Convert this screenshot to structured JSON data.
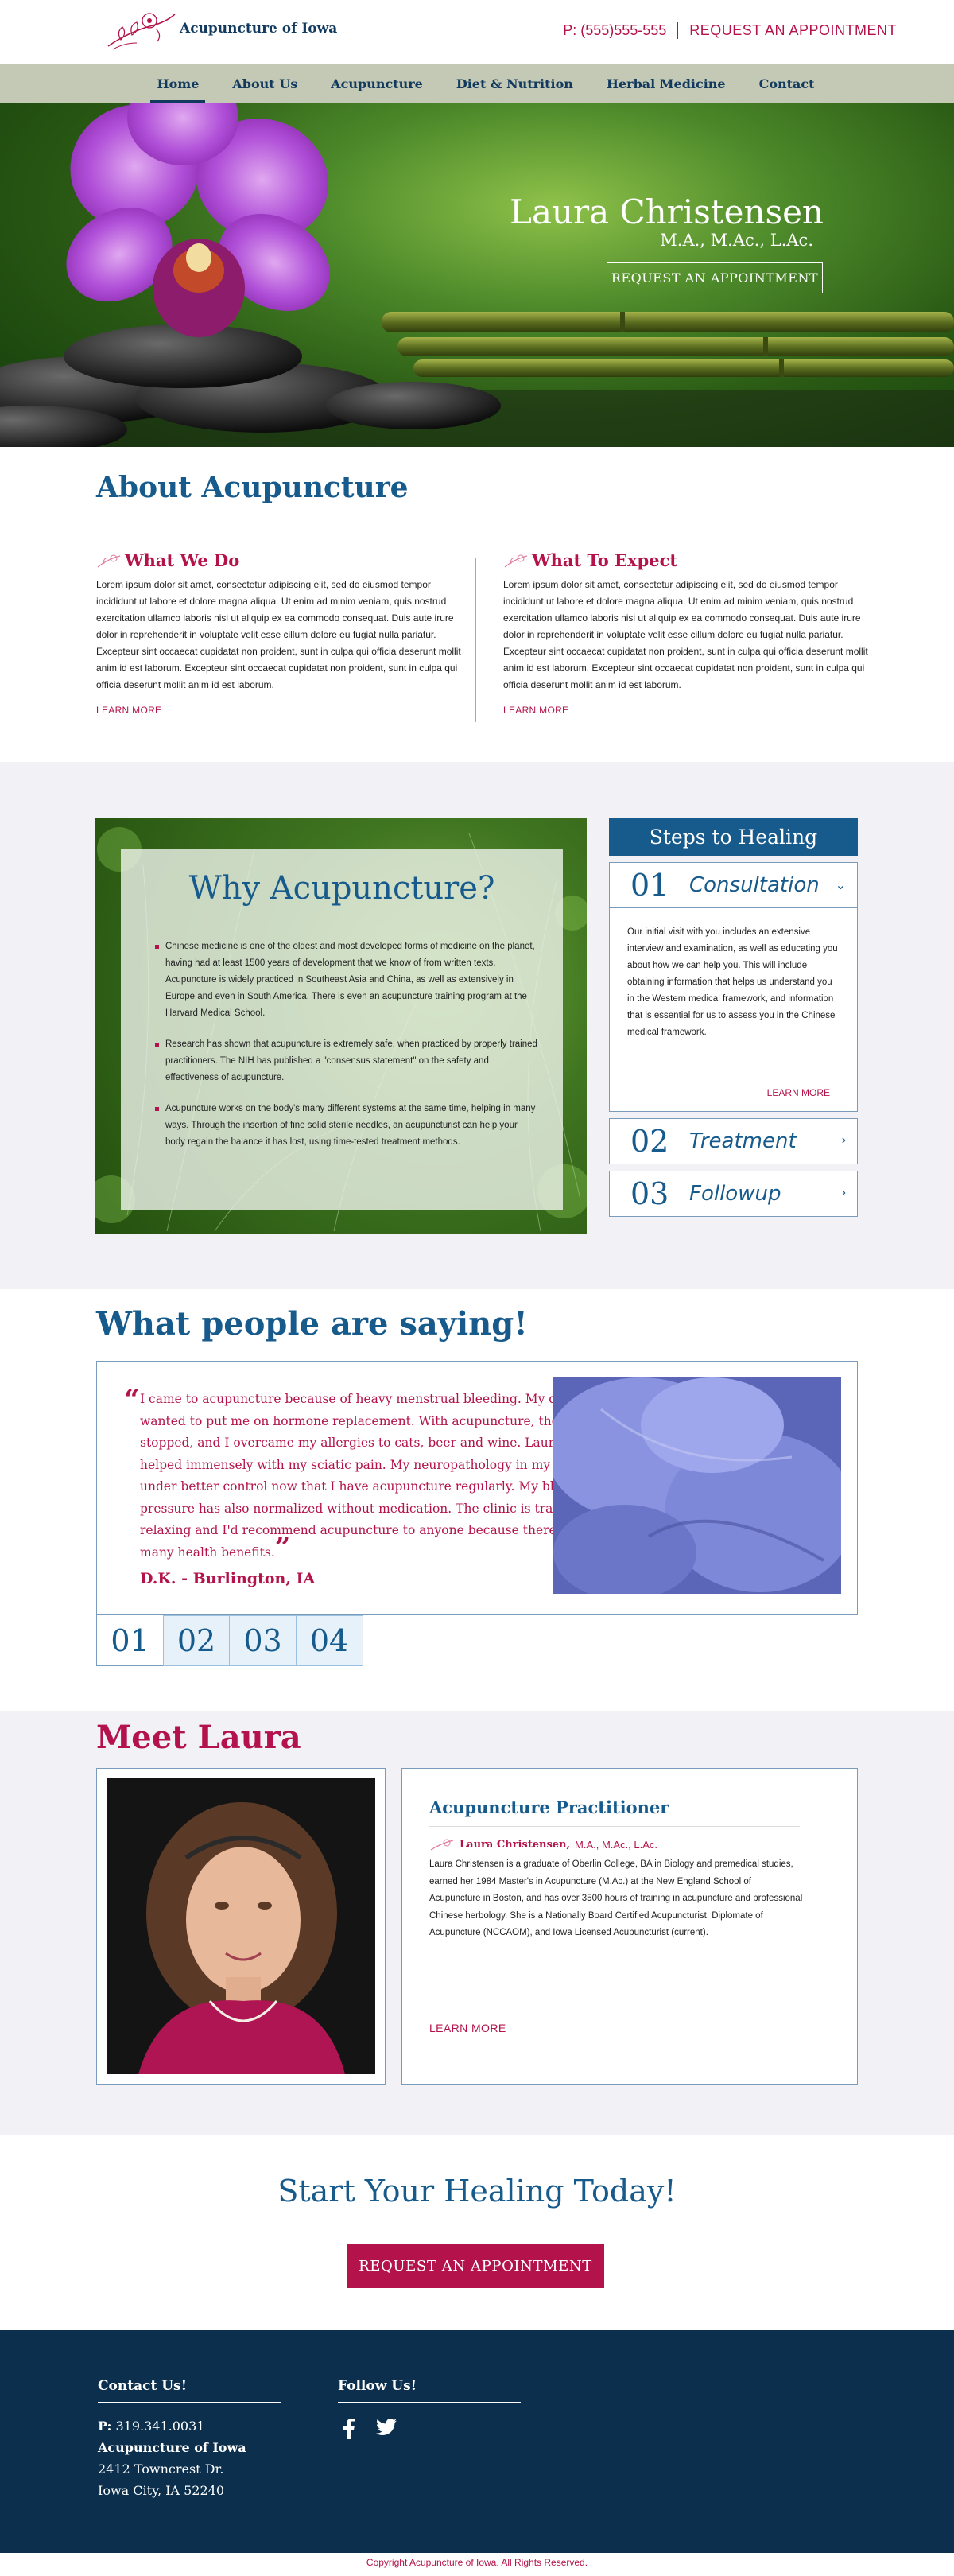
{
  "header": {
    "brand": "Acupuncture of Iowa",
    "phone": "P: (555)555-555",
    "appointment_link": "REQUEST AN APPOINTMENT"
  },
  "nav": {
    "items": [
      "Home",
      "About Us",
      "Acupuncture",
      "Diet & Nutrition",
      "Herbal Medicine",
      "Contact"
    ]
  },
  "hero": {
    "name": "Laura Christensen",
    "credentials": "M.A., M.Ac., L.Ac.",
    "button": "REQUEST AN APPOINTMENT"
  },
  "about": {
    "title": "About Acupuncture",
    "col1": {
      "heading": "What We Do",
      "text": "Lorem ipsum dolor sit amet, consectetur adipiscing elit, sed do eiusmod tempor incididunt ut labore et dolore magna aliqua. Ut enim ad minim veniam, quis nostrud exercitation ullamco laboris nisi ut aliquip ex ea commodo consequat. Duis aute irure dolor in reprehenderit in voluptate velit esse cillum dolore eu fugiat nulla pariatur. Excepteur sint occaecat cupidatat non proident, sunt in culpa qui officia deserunt mollit anim id est laborum.  Excepteur sint occaecat cupidatat non proident, sunt in culpa qui officia deserunt mollit anim id est laborum.",
      "more": "LEARN MORE"
    },
    "col2": {
      "heading": "What To Expect",
      "text": "Lorem ipsum dolor sit amet, consectetur adipiscing elit, sed do eiusmod tempor incididunt ut labore et dolore magna aliqua. Ut enim ad minim veniam, quis nostrud exercitation ullamco laboris nisi ut aliquip ex ea commodo consequat. Duis aute irure dolor in reprehenderit in voluptate velit esse cillum dolore eu fugiat nulla pariatur. Excepteur sint occaecat cupidatat non proident, sunt in culpa qui officia deserunt mollit anim id est laborum. Excepteur sint occaecat cupidatat non proident, sunt in culpa qui officia deserunt mollit anim id est laborum.",
      "more": "LEARN MORE"
    }
  },
  "why": {
    "title": "Why Acupuncture?",
    "points": [
      "Chinese medicine is one of the oldest and most developed forms of medicine on the planet, having had at least 1500 years of development that we know of from written texts. Acupuncture is widely practiced in Southeast Asia and China, as well as extensively in Europe and even in South America. There is even an acupuncture training program at the Harvard Medical School.",
      "Research has shown that acupuncture is extremely safe, when practiced by properly trained practitioners. The NIH has published a \"consensus statement\" on the safety and effectiveness of acupuncture.",
      "Acupuncture works on the body's many different systems at the same time, helping in many ways.  Through the insertion of fine solid sterile needles, an acupuncturist can help your body regain the balance it has lost, using time-tested treatment methods."
    ]
  },
  "steps": {
    "title": "Steps to Healing",
    "items": [
      {
        "num": "01",
        "name": "Consultation"
      },
      {
        "num": "02",
        "name": "Treatment"
      },
      {
        "num": "03",
        "name": "Followup"
      }
    ],
    "open_text": "Our initial visit with you includes an extensive interview and examination, as well as educating you about how we can help you. This will include obtaining information that helps us understand you in the Western medical framework, and information that is essential for us to assess you in the Chinese medical framework.",
    "more": "LEARN MORE"
  },
  "testimonials": {
    "title": "What people are saying!",
    "quote": "I came to acupuncture because of heavy menstrual bleeding. My doctor wanted to put me on hormone replacement. With acupuncture, the bleeding stopped, and I overcame my allergies to cats, beer and wine. Laura has also helped immensely with my sciatic pain. My neuropathology in my feet is also under better control now that I have acupuncture regularly. My blood pressure has also normalized without medication. The clinic is tranquil and relaxing and I'd recommend acupuncture to anyone because there are so many health benefits.",
    "author": "D.K. - Burlington, IA",
    "tabs": [
      "01",
      "02",
      "03",
      "04"
    ]
  },
  "meet": {
    "title": "Meet Laura",
    "bio_title": "Acupuncture Practitioner",
    "bio_name": "Laura Christensen,",
    "bio_cred": "M.A., M.Ac., L.Ac.",
    "bio_text": "Laura Christensen is a graduate of Oberlin College, BA in Biology and premedical studies, earned her 1984 Master's in Acupuncture (M.Ac.) at the New England School of Acupuncture in Boston, and has over 3500 hours of training in acupuncture and professional Chinese herbology. She is a Nationally Board Certified Acupuncturist, Diplomate of Acupuncture (NCCAOM), and Iowa Licensed Acupuncturist (current).",
    "more": "LEARN MORE"
  },
  "cta": {
    "title": "Start Your Healing Today!",
    "button": "REQUEST AN APPOINTMENT"
  },
  "footer": {
    "contact_heading": "Contact Us!",
    "phone_label": "P:",
    "phone": "319.341.0031",
    "org": "Acupuncture of Iowa",
    "address1": "2412 Towncrest Dr.",
    "address2": "Iowa City, IA 52240",
    "follow_heading": "Follow Us!",
    "copyright": "Copyright Acupuncture of Iowa. All Rights Reserved."
  },
  "colors": {
    "brand_blue": "#175a8c",
    "accent_magenta": "#b3134a",
    "footer_navy": "#0b2f4c"
  },
  "icons": [
    "orchid-logo-icon",
    "chevron-down-icon",
    "chevron-right-icon",
    "quote-open-icon",
    "quote-close-icon",
    "facebook-icon",
    "twitter-icon"
  ]
}
